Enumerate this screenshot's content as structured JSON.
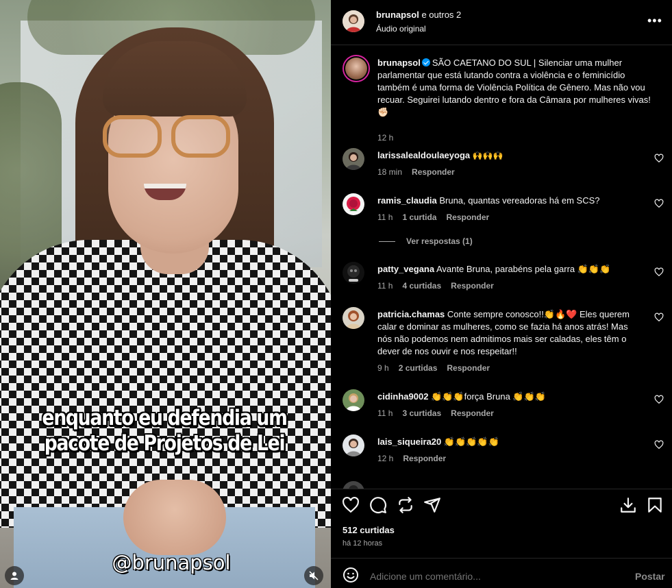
{
  "video": {
    "caption_line1": "enquanto eu defendia um",
    "caption_line2": "pacote de Projetos de Lei",
    "handle": "@brunapsol"
  },
  "header": {
    "username": "brunapsol",
    "coauthors": " e outros 2",
    "audio": "Áudio original",
    "more": "•••"
  },
  "post": {
    "username": "brunapsol",
    "caption": "SÃO CAETANO DO SUL | Silenciar uma mulher parlamentar que está lutando contra a violência e o feminicídio também é uma forma de Violência Política de Gênero. Mas não vou recuar. Seguirei lutando dentro e fora da Câmara por mulheres vivas! ✊🏻",
    "time": "12 h"
  },
  "comments": [
    {
      "username": "larissalealdoulaeyoga",
      "text": "🙌🙌🙌",
      "time": "18 min",
      "likes": "",
      "reply": "Responder"
    },
    {
      "username": "ramis_claudia",
      "text": "Bruna, quantas vereadoras há em SCS?",
      "time": "11 h",
      "likes": "1 curtida",
      "reply": "Responder"
    },
    {
      "username": "patty_vegana",
      "text": "Avante Bruna, parabéns pela garra 👏👏👏",
      "time": "11 h",
      "likes": "4 curtidas",
      "reply": "Responder"
    },
    {
      "username": "patricia.chamas",
      "text": "Conte sempre conosco!!👏🔥❤️ Eles querem calar e dominar as mulheres, como se fazia há anos atrás! Mas nós não podemos nem admitimos mais ser caladas, eles têm o dever de nos ouvir e nos respeitar!!",
      "time": "9 h",
      "likes": "2 curtidas",
      "reply": "Responder"
    },
    {
      "username": "cidinha9002",
      "text": "👏👏👏força Bruna 👏👏👏",
      "time": "11 h",
      "likes": "3 curtidas",
      "reply": "Responder"
    },
    {
      "username": "lais_siqueira20",
      "text": "👏👏👏👏👏",
      "time": "12 h",
      "likes": "",
      "reply": "Responder"
    }
  ],
  "view_replies": "Ver respostas (1)",
  "actions": {
    "likes_count": "512 curtidas",
    "ago": "há 12 horas"
  },
  "composer": {
    "placeholder": "Adicione um comentário...",
    "post_label": "Postar"
  },
  "icons": {
    "like": "heart-icon",
    "comment": "comment-icon",
    "repost": "repost-icon",
    "share": "share-icon",
    "download": "download-icon",
    "save": "bookmark-icon",
    "emoji": "emoji-icon",
    "mute": "muted-speaker-icon",
    "user": "user-icon"
  },
  "colors": {
    "background": "#000000",
    "text": "#f5f5f5",
    "muted": "#a8a8a8",
    "divider": "#262626",
    "verified": "#0095f6"
  }
}
